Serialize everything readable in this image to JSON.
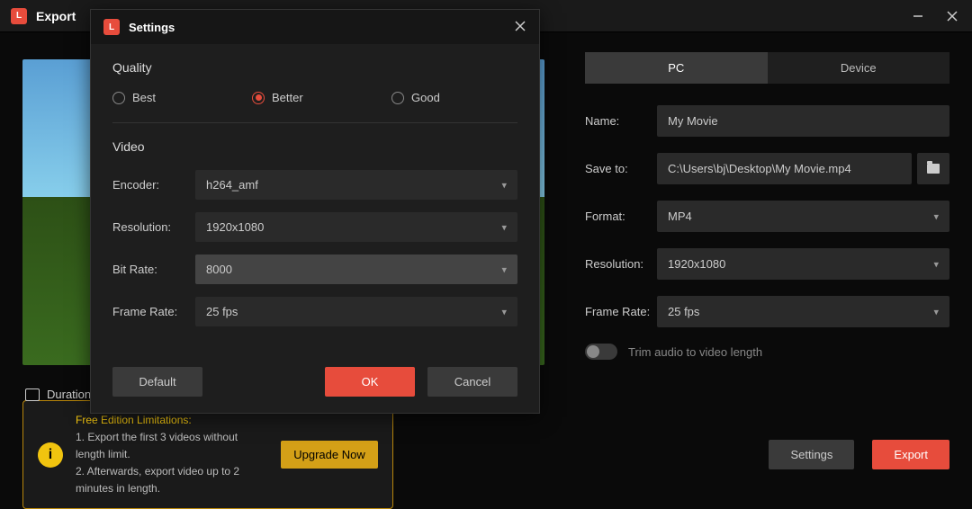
{
  "titlebar": {
    "title": "Export"
  },
  "preview": {
    "duration_label": "Duration"
  },
  "tabs": {
    "pc": "PC",
    "device": "Device"
  },
  "form": {
    "name_label": "Name:",
    "name_value": "My Movie",
    "saveto_label": "Save to:",
    "saveto_value": "C:\\Users\\bj\\Desktop\\My Movie.mp4",
    "format_label": "Format:",
    "format_value": "MP4",
    "resolution_label": "Resolution:",
    "resolution_value": "1920x1080",
    "framerate_label": "Frame Rate:",
    "framerate_value": "25 fps",
    "trim_label": "Trim audio to video length"
  },
  "limitation": {
    "title": "Free Edition Limitations:",
    "line1": "1. Export the first 3 videos without length limit.",
    "line2": "2. Afterwards, export video up to 2 minutes in length.",
    "upgrade": "Upgrade Now"
  },
  "footer": {
    "settings": "Settings",
    "export": "Export"
  },
  "modal": {
    "title": "Settings",
    "quality_section": "Quality",
    "quality": {
      "best": "Best",
      "better": "Better",
      "good": "Good"
    },
    "video_section": "Video",
    "encoder_label": "Encoder:",
    "encoder_value": "h264_amf",
    "resolution_label": "Resolution:",
    "resolution_value": "1920x1080",
    "bitrate_label": "Bit Rate:",
    "bitrate_value": "8000",
    "framerate_label": "Frame Rate:",
    "framerate_value": "25 fps",
    "default_btn": "Default",
    "ok_btn": "OK",
    "cancel_btn": "Cancel"
  }
}
